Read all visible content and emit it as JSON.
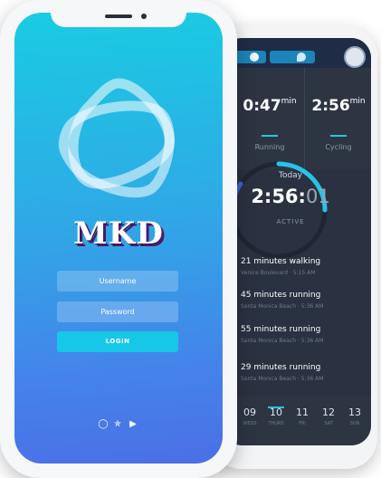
{
  "brand": {
    "name": "MKD"
  },
  "login": {
    "username_placeholder": "Username",
    "password_placeholder": "Password",
    "button_label": "LOGIN",
    "social_icons": [
      "dribbble-icon",
      "twitter-icon",
      "youtube-icon"
    ]
  },
  "dashboard": {
    "stats": [
      {
        "value": "0:47",
        "unit": "min",
        "label": "Running"
      },
      {
        "value": "2:56",
        "unit": "min",
        "label": "Cycling"
      }
    ],
    "today": {
      "label": "Today",
      "time_main": "2:56:",
      "time_dim": "01",
      "status": "ACTIVE"
    },
    "activities": [
      {
        "title": "21 minutes walking",
        "subtitle": "Venice Boulevard · 5:15 AM"
      },
      {
        "title": "45 minutes running",
        "subtitle": "Santa Monica Beach · 5:36 AM"
      },
      {
        "title": "55 minutes running",
        "subtitle": "Santa Monica Beach · 5:36 AM"
      },
      {
        "title": "29 minutes running",
        "subtitle": "Santa Monica Beach · 5:36 AM"
      }
    ],
    "days": [
      {
        "num": "09",
        "label": "WEDS"
      },
      {
        "num": "10",
        "label": "THURS"
      },
      {
        "num": "11",
        "label": "FRI"
      },
      {
        "num": "12",
        "label": "SAT"
      },
      {
        "num": "13",
        "label": "SUN"
      }
    ]
  },
  "colors": {
    "accent": "#27c3e6",
    "dark_bg": "#2a3140",
    "login_button": "#16c7e8"
  }
}
